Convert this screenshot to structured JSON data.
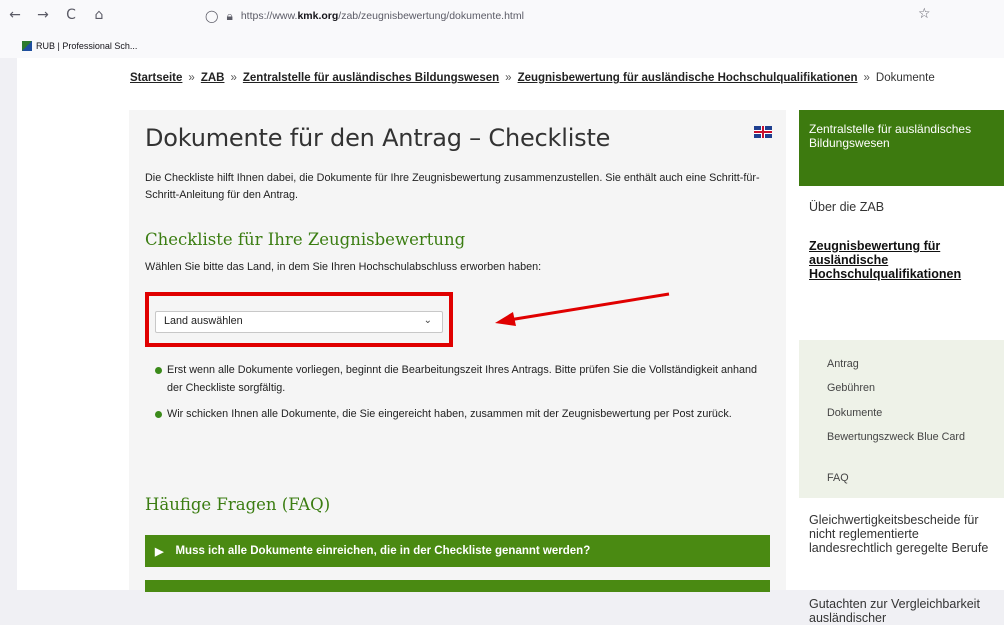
{
  "browser": {
    "url_prefix": "https://www.",
    "url_domain": "kmk.org",
    "url_path": "/zab/zeugnisbewertung/dokumente.html",
    "bookmark": "RUB | Professional Sch..."
  },
  "breadcrumb": {
    "items": [
      "Startseite",
      "ZAB",
      "Zentralstelle für ausländisches Bildungswesen",
      "Zeugnisbewertung für ausländische Hochschulqualifikationen"
    ],
    "current": "Dokumente",
    "separator": "»"
  },
  "main": {
    "title": "Dokumente für den Antrag – Checkliste",
    "intro": "Die Checkliste hilft Ihnen dabei, die Dokumente für Ihre Zeugnisbewertung zusammenzustellen. Sie enthält auch eine Schritt-für-Schritt-Anleitung für den Antrag.",
    "checklist_heading": "Checkliste für Ihre Zeugnisbewertung",
    "choose_text": "Wählen Sie bitte das Land, in dem Sie Ihren Hochschulabschluss erworben haben:",
    "country_select": "Land auswählen",
    "bullets": [
      "Erst wenn alle Dokumente vorliegen, beginnt die Bearbeitungszeit Ihres Antrags. Bitte prüfen Sie die Vollständigkeit anhand der Checkliste sorgfältig.",
      "Wir schicken Ihnen alle Dokumente, die Sie eingereicht haben, zusammen mit der Zeugnisbewertung per Post zurück."
    ],
    "faq_heading": "Häufige Fragen (FAQ)",
    "faq_items": [
      "Muss ich alle Dokumente einreichen, die in der Checkliste genannt werden?"
    ]
  },
  "sidebar": {
    "header": "Zentralstelle für ausländisches Bildungswesen",
    "about": "Über die ZAB",
    "active": "Zeugnisbewertung für ausländische Hochschulqualifikationen",
    "subitems": [
      "Antrag",
      "Gebühren",
      "Dokumente",
      "Bewertungszweck Blue Card",
      "FAQ"
    ],
    "more": [
      "Gleichwertigkeitsbescheide für nicht reglementierte landesrechtlich geregelte Berufe",
      "Gutachten zur Vergleichbarkeit ausländischer"
    ]
  },
  "colors": {
    "accent_green": "#3d7a0f",
    "heading_green": "#3b7d12",
    "highlight_red": "#e00000"
  },
  "icons": [
    "back-icon",
    "forward-icon",
    "reload-icon",
    "home-icon",
    "shield-icon",
    "lock-icon",
    "star-icon",
    "uk-flag-icon",
    "chevron-down-icon",
    "triangle-right-icon",
    "red-arrow"
  ]
}
